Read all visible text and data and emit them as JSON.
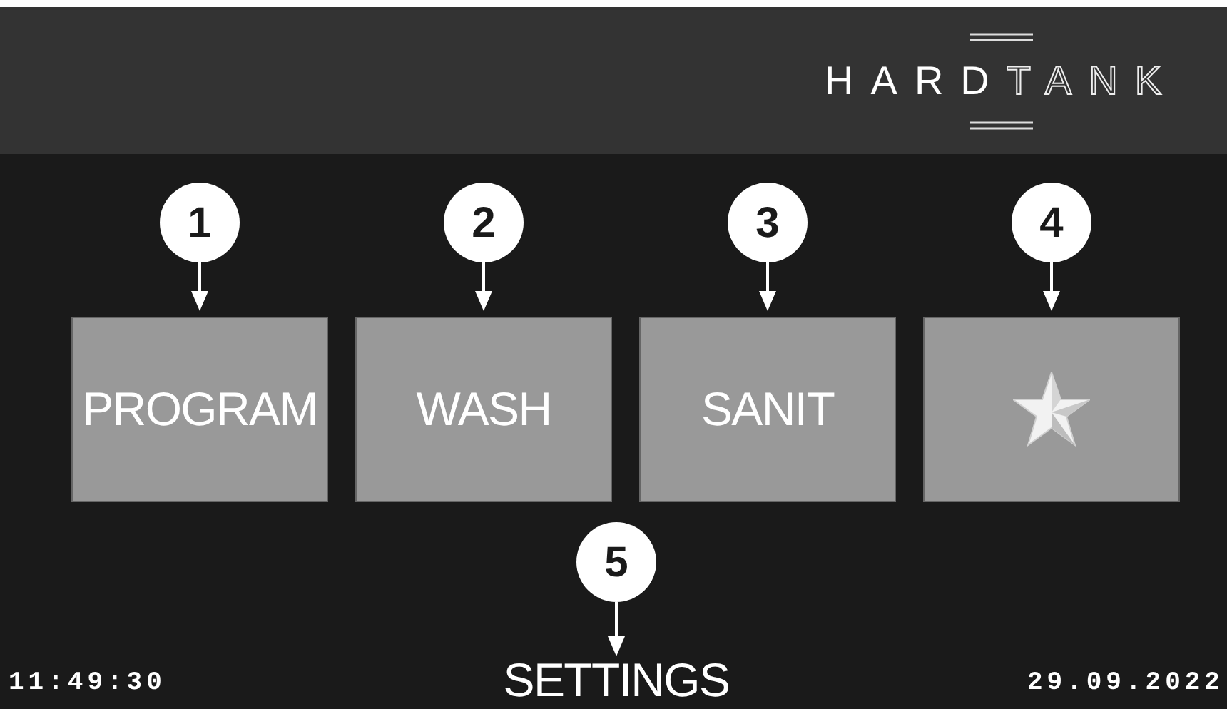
{
  "header": {
    "logo_solid": "HARD",
    "logo_outline": "TANK"
  },
  "tiles": [
    {
      "callout": "1",
      "kind": "text",
      "label": "PROGRAM"
    },
    {
      "callout": "2",
      "kind": "text",
      "label": "WASH"
    },
    {
      "callout": "3",
      "kind": "text",
      "label": "SANIT"
    },
    {
      "callout": "4",
      "kind": "star"
    }
  ],
  "settings": {
    "callout": "5",
    "label": "SETTINGS"
  },
  "status_bar": {
    "time": "11:49:30",
    "date": "29.09.2022"
  }
}
